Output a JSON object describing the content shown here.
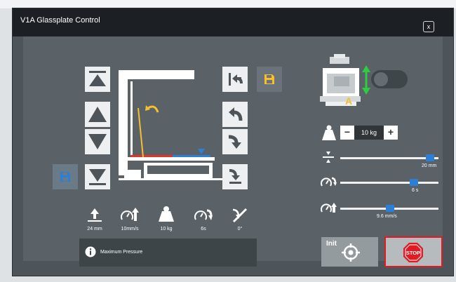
{
  "window": {
    "title": "V1A Glassplate Control",
    "close_label": "x"
  },
  "icons": {
    "btn_top": "move-to-top-icon",
    "btn_up": "arrow-up-icon",
    "btn_down": "arrow-down-icon",
    "btn_bottom": "move-to-bottom-icon",
    "btn_save_left": "save-icon",
    "btn_save_top": "save-icon",
    "btn_return_top": "return-icon",
    "btn_rotate_back": "rotate-back-icon",
    "btn_rotate_down": "rotate-down-icon",
    "btn_lower": "lower-icon"
  },
  "stats": [
    {
      "name": "position",
      "icon": "arrow-up-line-icon",
      "value": "24 mm"
    },
    {
      "name": "speed",
      "icon": "gauge-up-icon",
      "value": "10mm/s"
    },
    {
      "name": "weight",
      "icon": "weight-icon",
      "value": "10 kg"
    },
    {
      "name": "time",
      "icon": "gauge-rotate-icon",
      "value": "6s"
    },
    {
      "name": "angle",
      "icon": "angle-icon",
      "value": "0°"
    }
  ],
  "info": {
    "icon": "info-icon",
    "text": "Maximum Pressure"
  },
  "mode": {
    "label": "A",
    "toggle_on": false
  },
  "weight": {
    "minus": "−",
    "value": "10 kg",
    "plus": "+"
  },
  "sliders": [
    {
      "name": "gap",
      "icon": "gap-icon",
      "value": "20 mm",
      "level": 0.95
    },
    {
      "name": "time",
      "icon": "gauge-rotate-icon",
      "value": "6 s",
      "level": 0.77
    },
    {
      "name": "speed",
      "icon": "gauge-up-icon",
      "value": "9.6 mm/s",
      "level": 0.51
    }
  ],
  "actions": {
    "init_label": "Init",
    "stop_label": "STOP"
  },
  "colors": {
    "accent_blue": "#2d7fd6",
    "save_yellow": "#f5c02c",
    "stop_red": "#e01b24",
    "arrow_green": "#2ecc40",
    "bar_red": "#e0332a"
  }
}
